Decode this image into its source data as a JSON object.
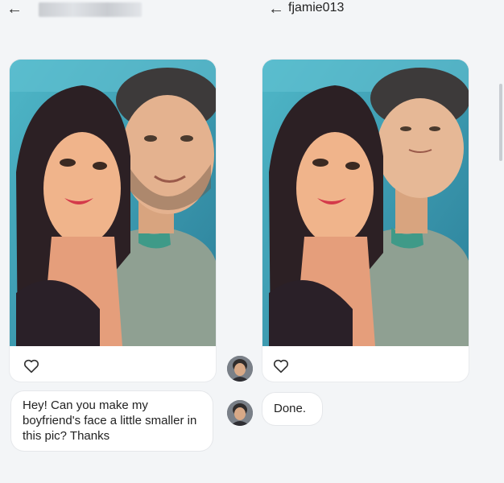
{
  "header": {
    "back_icon": "arrow-left-icon",
    "right_username": "fjamie013"
  },
  "left_post": {
    "like_icon": "heart-icon"
  },
  "right_post": {
    "like_icon": "heart-icon"
  },
  "messages": {
    "left": "Hey! Can you make my boyfriend's face a little smaller in this pic? Thanks",
    "right": "Done."
  },
  "colors": {
    "background": "#f3f5f7",
    "bubble": "#ffffff",
    "text": "#222222"
  }
}
